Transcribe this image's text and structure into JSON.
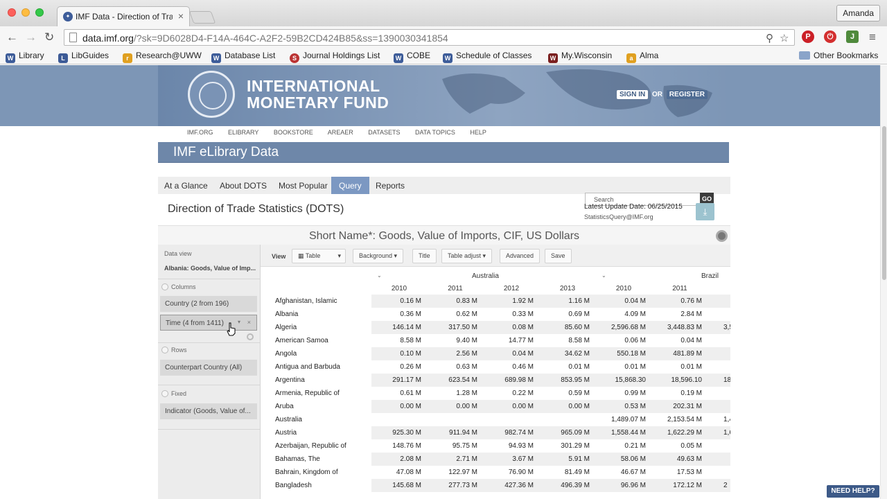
{
  "browser": {
    "tab_title": "IMF Data - Direction of Tra",
    "user": "Amanda",
    "url_host": "data.imf.org",
    "url_path": "/?sk=9D6028D4-F14A-464C-A2F2-59B2CD424B85&ss=1390030341854"
  },
  "bookmarks": [
    {
      "label": "Library",
      "color": "#3d5c99"
    },
    {
      "label": "LibGuides",
      "color": "#3c5a96"
    },
    {
      "label": "Research@UWW",
      "color": "#e0a020"
    },
    {
      "label": "Database List",
      "color": "#3d5c99"
    },
    {
      "label": "Journal Holdings List",
      "color": "#b33"
    },
    {
      "label": "COBE",
      "color": "#3d5c99"
    },
    {
      "label": "Schedule of Classes",
      "color": "#3d5c99"
    },
    {
      "label": "My.Wisconsin",
      "color": "#7a1f1f"
    },
    {
      "label": "Alma",
      "color": "#e0a020"
    },
    {
      "label": "Other Bookmarks",
      "color": "#8aa4c9"
    }
  ],
  "header": {
    "org_line1": "INTERNATIONAL",
    "org_line2": "MONETARY FUND",
    "sign_in": "SIGN IN",
    "or": "OR",
    "register": "REGISTER"
  },
  "topnav": [
    "IMF.ORG",
    "ELIBRARY",
    "BOOKSTORE",
    "AREAER",
    "DATASETS",
    "DATA TOPICS",
    "HELP"
  ],
  "lib_title": "IMF eLibrary Data",
  "tabs": [
    "At a Glance",
    "About DOTS",
    "Most Popular",
    "Query",
    "Reports"
  ],
  "search": {
    "placeholder": "Search",
    "go": "GO"
  },
  "dataset_title": "Direction of Trade Statistics (DOTS)",
  "update": {
    "label": "Latest Update Date:",
    "date": "06/25/2015",
    "email": "StatisticsQuery@IMF.org"
  },
  "short_name": "Short Name*: Goods, Value of Imports, CIF, US Dollars",
  "sidebar": {
    "data_view_label": "Data view",
    "data_view_value": "Albania: Goods, Value of Imp...",
    "columns_label": "Columns",
    "country_chip": "Country (2 from 196)",
    "time_chip": "Time (4 from 1411)",
    "rows_label": "Rows",
    "counterpart_chip": "Counterpart Country (All)",
    "fixed_label": "Fixed",
    "indicator_chip": "Indicator (Goods, Value of..."
  },
  "viewbar": {
    "view": "View",
    "table": "Table",
    "background": "Background",
    "title": "Title",
    "table_adjust": "Table adjust",
    "advanced": "Advanced",
    "save": "Save"
  },
  "table": {
    "countries": [
      "Australia",
      "Brazil"
    ],
    "years": [
      "2010",
      "2011",
      "2012",
      "2013",
      "2010",
      "2011",
      "2"
    ],
    "rows": [
      {
        "name": "Afghanistan, Islamic",
        "vals": [
          "0.16 M",
          "0.83 M",
          "1.92 M",
          "1.16 M",
          "0.04 M",
          "0.76 M",
          ""
        ]
      },
      {
        "name": "Albania",
        "vals": [
          "0.36 M",
          "0.62 M",
          "0.33 M",
          "0.69 M",
          "4.09 M",
          "2.84 M",
          ""
        ]
      },
      {
        "name": "Algeria",
        "vals": [
          "146.14 M",
          "317.50 M",
          "0.08 M",
          "85.60 M",
          "2,596.68 M",
          "3,448.83 M",
          "3,5"
        ]
      },
      {
        "name": "American Samoa",
        "vals": [
          "8.58 M",
          "9.40 M",
          "14.77 M",
          "8.58 M",
          "0.06 M",
          "0.04 M",
          ""
        ]
      },
      {
        "name": "Angola",
        "vals": [
          "0.10 M",
          "2.56 M",
          "0.04 M",
          "34.62 M",
          "550.18 M",
          "481.89 M",
          ""
        ]
      },
      {
        "name": "Antigua and Barbuda",
        "vals": [
          "0.26 M",
          "0.63 M",
          "0.46 M",
          "0.01 M",
          "0.01 M",
          "0.01 M",
          ""
        ]
      },
      {
        "name": "Argentina",
        "vals": [
          "291.17 M",
          "623.54 M",
          "689.98 M",
          "853.95 M",
          "15,868.30",
          "18,596.10",
          "18"
        ]
      },
      {
        "name": "Armenia, Republic of",
        "vals": [
          "0.61 M",
          "1.28 M",
          "0.22 M",
          "0.59 M",
          "0.99 M",
          "0.19 M",
          ""
        ]
      },
      {
        "name": "Aruba",
        "vals": [
          "0.00 M",
          "0.00 M",
          "0.00 M",
          "0.00 M",
          "0.53 M",
          "202.31 M",
          ""
        ]
      },
      {
        "name": "Australia",
        "vals": [
          "",
          "",
          "",
          "",
          "1,489.07 M",
          "2,153.54 M",
          "1,4"
        ]
      },
      {
        "name": "Austria",
        "vals": [
          "925.30 M",
          "911.94 M",
          "982.74 M",
          "965.09 M",
          "1,558.44 M",
          "1,622.29 M",
          "1,6"
        ]
      },
      {
        "name": "Azerbaijan, Republic of",
        "vals": [
          "148.76 M",
          "95.75 M",
          "94.93 M",
          "301.29 M",
          "0.21 M",
          "0.05 M",
          ""
        ]
      },
      {
        "name": "Bahamas, The",
        "vals": [
          "2.08 M",
          "2.71 M",
          "3.67 M",
          "5.91 M",
          "58.06 M",
          "49.63 M",
          ""
        ]
      },
      {
        "name": "Bahrain, Kingdom of",
        "vals": [
          "47.08 M",
          "122.97 M",
          "76.90 M",
          "81.49 M",
          "46.67 M",
          "17.53 M",
          ""
        ]
      },
      {
        "name": "Bangladesh",
        "vals": [
          "145.68 M",
          "277.73 M",
          "427.36 M",
          "496.39 M",
          "96.96 M",
          "172.12 M",
          "2"
        ]
      }
    ]
  },
  "need_help": "NEED HELP?"
}
